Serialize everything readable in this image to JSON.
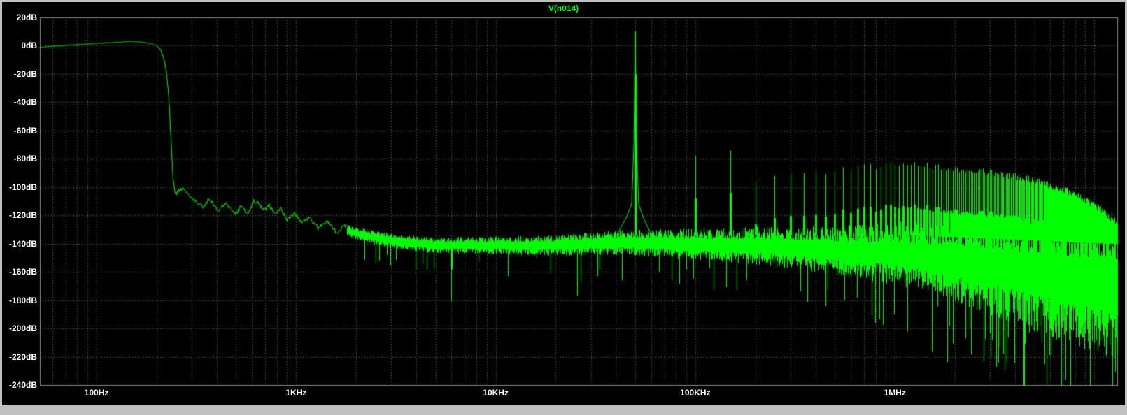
{
  "colors": {
    "outer_frame": "#c0c0c0",
    "plot_background": "#000000",
    "grid": "#7a7a7a",
    "border": "#8a8a8a",
    "axis_text": "#ffffff",
    "title_text": "#00ff00",
    "trace": "#00ff00"
  },
  "chart_data": {
    "type": "line",
    "title": "V(n014)",
    "x_scale": "log",
    "x_min_hz": 52,
    "x_max_hz": 13000000,
    "ylim": [
      -240,
      20
    ],
    "y_unit": "dB",
    "y_ticks": [
      {
        "label": "20dB",
        "db": 20
      },
      {
        "label": "0dB",
        "db": 0
      },
      {
        "label": "-20dB",
        "db": -20
      },
      {
        "label": "-40dB",
        "db": -40
      },
      {
        "label": "-60dB",
        "db": -60
      },
      {
        "label": "-80dB",
        "db": -80
      },
      {
        "label": "-100dB",
        "db": -100
      },
      {
        "label": "-120dB",
        "db": -120
      },
      {
        "label": "-140dB",
        "db": -140
      },
      {
        "label": "-160dB",
        "db": -160
      },
      {
        "label": "-180dB",
        "db": -180
      },
      {
        "label": "-200dB",
        "db": -200
      },
      {
        "label": "-220dB",
        "db": -220
      },
      {
        "label": "-240dB",
        "db": -240
      }
    ],
    "x_ticks": [
      {
        "label": "100Hz",
        "hz": 100
      },
      {
        "label": "1KHz",
        "hz": 1000
      },
      {
        "label": "10KHz",
        "hz": 10000
      },
      {
        "label": "100KHz",
        "hz": 100000
      },
      {
        "label": "1MHz",
        "hz": 1000000
      }
    ],
    "trace_color": "#00ff00",
    "series": {
      "baseband_points_hz_db": [
        [
          52,
          -1.2
        ],
        [
          62,
          -0.3
        ],
        [
          75,
          0.5
        ],
        [
          90,
          1.2
        ],
        [
          110,
          2.0
        ],
        [
          130,
          2.6
        ],
        [
          150,
          3.0
        ],
        [
          170,
          2.5
        ],
        [
          188,
          1.2
        ],
        [
          200,
          0.0
        ],
        [
          208,
          -2.5
        ],
        [
          216,
          -8
        ],
        [
          224,
          -20
        ],
        [
          230,
          -40
        ],
        [
          236,
          -70
        ],
        [
          241,
          -95
        ],
        [
          247,
          -105
        ],
        [
          255,
          -103
        ],
        [
          268,
          -101
        ],
        [
          282,
          -105
        ],
        [
          300,
          -107
        ],
        [
          320,
          -112
        ],
        [
          345,
          -114
        ],
        [
          365,
          -108
        ],
        [
          385,
          -112
        ],
        [
          410,
          -117
        ],
        [
          440,
          -111
        ],
        [
          470,
          -116
        ],
        [
          500,
          -119
        ],
        [
          530,
          -113
        ],
        [
          570,
          -119
        ],
        [
          610,
          -110
        ],
        [
          650,
          -112
        ],
        [
          690,
          -117
        ],
        [
          730,
          -112
        ],
        [
          780,
          -120
        ],
        [
          830,
          -115
        ],
        [
          900,
          -123
        ],
        [
          980,
          -118
        ],
        [
          1060,
          -126
        ],
        [
          1160,
          -121
        ],
        [
          1280,
          -129
        ],
        [
          1420,
          -124
        ],
        [
          1580,
          -132
        ],
        [
          1750,
          -127
        ],
        [
          2000,
          -133
        ]
      ],
      "noise_center_hz_db": [
        [
          1800,
          -131
        ],
        [
          2500,
          -136
        ],
        [
          3500,
          -139
        ],
        [
          5000,
          -141
        ],
        [
          10000,
          -141
        ],
        [
          20000,
          -141
        ],
        [
          40000,
          -139
        ],
        [
          60000,
          -139
        ],
        [
          100000,
          -140
        ],
        [
          200000,
          -141
        ],
        [
          400000,
          -143
        ],
        [
          700000,
          -145
        ],
        [
          1200000,
          -147
        ],
        [
          2000000,
          -151
        ],
        [
          3500000,
          -156
        ],
        [
          6000000,
          -161
        ],
        [
          13000000,
          -168
        ]
      ],
      "noise_halfwidth_db": [
        [
          1800,
          4
        ],
        [
          5000,
          5
        ],
        [
          15000,
          6
        ],
        [
          50000,
          8
        ],
        [
          120000,
          10
        ],
        [
          300000,
          13
        ],
        [
          700000,
          17
        ],
        [
          1500000,
          23
        ],
        [
          3000000,
          30
        ],
        [
          6000000,
          38
        ],
        [
          13000000,
          46
        ]
      ],
      "needle_extra_db": [
        [
          2000,
          14
        ],
        [
          20000,
          22
        ],
        [
          100000,
          26
        ],
        [
          400000,
          34
        ],
        [
          1000000,
          44
        ],
        [
          3000000,
          52
        ],
        [
          13000000,
          58
        ]
      ],
      "deep_needles_hz_db": [
        [
          2600,
          -152
        ],
        [
          4300,
          -150
        ],
        [
          6000,
          -181
        ],
        [
          8200,
          -152
        ],
        [
          11500,
          -163
        ],
        [
          16000,
          -150
        ],
        [
          25500,
          -177
        ],
        [
          33000,
          -158
        ],
        [
          43000,
          -166
        ],
        [
          66000,
          -160
        ],
        [
          76000,
          -166
        ],
        [
          90000,
          -158
        ]
      ],
      "harmonics": {
        "fundamental_hz": 50000,
        "fundamental_peak_db": 10,
        "peak_envelope_hz_db": [
          [
            50000,
            10
          ],
          [
            100000,
            -78
          ],
          [
            150000,
            -74
          ],
          [
            200000,
            -96
          ],
          [
            250000,
            -92
          ],
          [
            300000,
            -89
          ],
          [
            400000,
            -90
          ],
          [
            500000,
            -88
          ],
          [
            700000,
            -86
          ],
          [
            1000000,
            -84
          ],
          [
            1500000,
            -85
          ],
          [
            2000000,
            -87
          ],
          [
            3000000,
            -90
          ],
          [
            5000000,
            -95
          ],
          [
            8000000,
            -105
          ],
          [
            11000000,
            -117
          ],
          [
            13000000,
            -128
          ]
        ]
      }
    },
    "render_hints": {
      "noise_seed": 14,
      "grid_dash": [
        1,
        3
      ],
      "legend_position": "top-center",
      "grid": true
    }
  }
}
